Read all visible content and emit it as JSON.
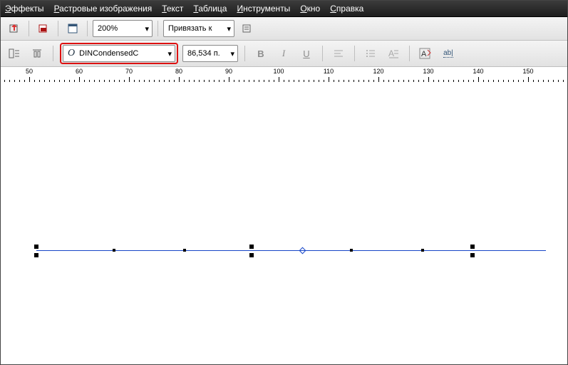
{
  "menu": {
    "effects": {
      "u": "Э",
      "rest": "ффекты"
    },
    "bitmaps": {
      "u": "Р",
      "rest": "астровые изображения"
    },
    "text": {
      "u": "Т",
      "rest": "екст"
    },
    "table": {
      "u": "Т",
      "rest": "аблица"
    },
    "tools": {
      "u": "И",
      "rest": "нструменты"
    },
    "window": {
      "u": "О",
      "rest": "кно"
    },
    "help": {
      "u": "С",
      "rest": "правка"
    }
  },
  "toolbar": {
    "zoom": "200%",
    "snap": "Привязать к"
  },
  "textbar": {
    "font": "DINCondensedC",
    "size": "86,534 п."
  },
  "ruler": {
    "start": 50,
    "end": 160,
    "major": 10,
    "pxPerUnit": 7
  }
}
